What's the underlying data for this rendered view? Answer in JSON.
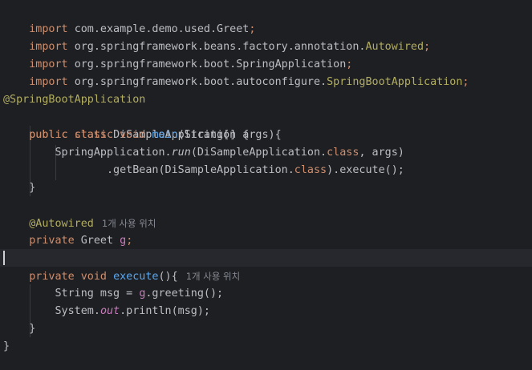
{
  "imports": [
    {
      "keyword": "import",
      "path": "com.example.demo.used.Greet",
      "highlight": "",
      "end": ";"
    },
    {
      "keyword": "import",
      "path": "org.springframework.beans.factory.annotation.",
      "highlight": "Autowired",
      "end": ";"
    },
    {
      "keyword": "import",
      "path": "org.springframework.boot.SpringApplication",
      "highlight": "",
      "end": ";"
    },
    {
      "keyword": "import",
      "path": "org.springframework.boot.autoconfigure.",
      "highlight": "SpringBootApplication",
      "end": ";"
    }
  ],
  "class_annotation": "@SpringBootApplication",
  "class_decl": {
    "kw1": "public",
    "kw2": "class",
    "name": "DiSampleApplication",
    "brace": " {"
  },
  "main_method": {
    "kw1": "public",
    "kw2": "static",
    "kw3": "void",
    "name": "main",
    "params": "(String[] args){"
  },
  "run_line": {
    "receiver": "SpringApplication.",
    "method": "run",
    "args_before": "(DiSampleApplication.",
    "class_kw": "class",
    "args_after": ", args)"
  },
  "getbean_line": {
    "prefix": ".getBean(DiSampleApplication.",
    "class_kw": "class",
    "suffix": ").execute();"
  },
  "close_brace": "}",
  "field_annotation": "@Autowired",
  "usage_hint_field": "1개 사용 위치",
  "field_decl": {
    "kw": "private",
    "type": "Greet",
    "name": "g",
    "end": ";"
  },
  "execute_method": {
    "kw1": "private",
    "kw2": "void",
    "name": "execute",
    "params": "(){",
    "usage_hint": "1개 사용 위치"
  },
  "msg_line": {
    "decl": "String msg = ",
    "field": "g",
    "call": ".greeting();"
  },
  "println_line": {
    "receiver": "System.",
    "static_field": "out",
    "call": ".println(msg);"
  },
  "theme": {
    "background": "#1e1f22",
    "keyword": "#cf8e6d",
    "function": "#56a8f5",
    "annotation": "#b3ae60",
    "field": "#c77dbb",
    "text": "#bcbec4",
    "hint": "#868993"
  }
}
